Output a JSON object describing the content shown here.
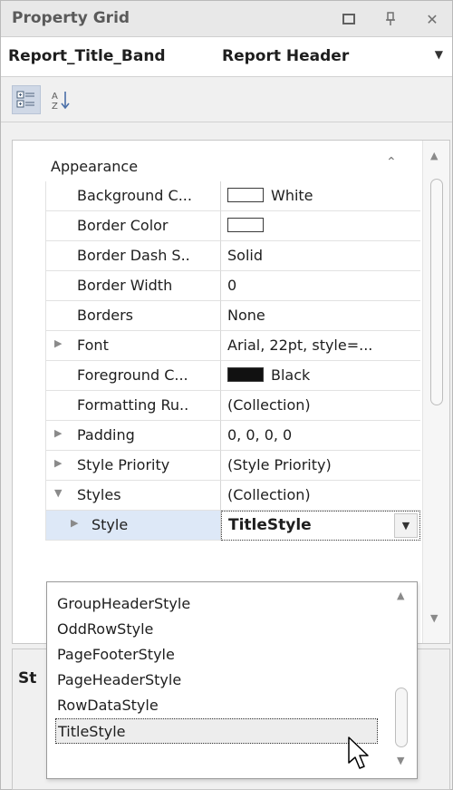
{
  "window": {
    "title": "Property Grid",
    "buttons": {
      "maximize_icon": "maximize-icon",
      "pin_icon": "pin-icon",
      "close_icon": "close-icon",
      "close_glyph": "✕"
    }
  },
  "object_selector": {
    "name": "Report_Title_Band",
    "type": "Report Header"
  },
  "toolbar": {
    "categorized_icon": "categorized-icon",
    "alphabetical_icon": "sort-alphabetical-icon"
  },
  "grid": {
    "category": "Appearance",
    "rows": [
      {
        "name": "Background C...",
        "value": "White",
        "swatch": "#ffffff",
        "expandable": false
      },
      {
        "name": "Border Color",
        "value": "",
        "swatch": "#ffffff",
        "expandable": false
      },
      {
        "name": "Border Dash S..",
        "value": "Solid",
        "expandable": false
      },
      {
        "name": "Border Width",
        "value": "0",
        "expandable": false
      },
      {
        "name": "Borders",
        "value": "None",
        "expandable": false
      },
      {
        "name": "Font",
        "value": "Arial, 22pt, style=...",
        "expandable": true
      },
      {
        "name": "Foreground C...",
        "value": "Black",
        "swatch": "#111111",
        "expandable": false
      },
      {
        "name": "Formatting Ru..",
        "value": "(Collection)",
        "expandable": false
      },
      {
        "name": "Padding",
        "value": "0, 0, 0, 0",
        "expandable": true
      },
      {
        "name": "Style Priority",
        "value": "(Style Priority)",
        "expandable": true
      },
      {
        "name": "Styles",
        "value": "(Collection)",
        "expandable": true,
        "expanded": true
      },
      {
        "name": "Style",
        "value": "TitleStyle",
        "expandable": true,
        "selected": true
      }
    ]
  },
  "description": {
    "label": "St"
  },
  "dropdown": {
    "options": [
      "GroupHeaderStyle",
      "OddRowStyle",
      "PageFooterStyle",
      "PageHeaderStyle",
      "RowDataStyle",
      "TitleStyle"
    ],
    "current": "TitleStyle"
  },
  "colors": {
    "selection": "#dde8f7",
    "panel_bg": "#f0f0f0"
  }
}
